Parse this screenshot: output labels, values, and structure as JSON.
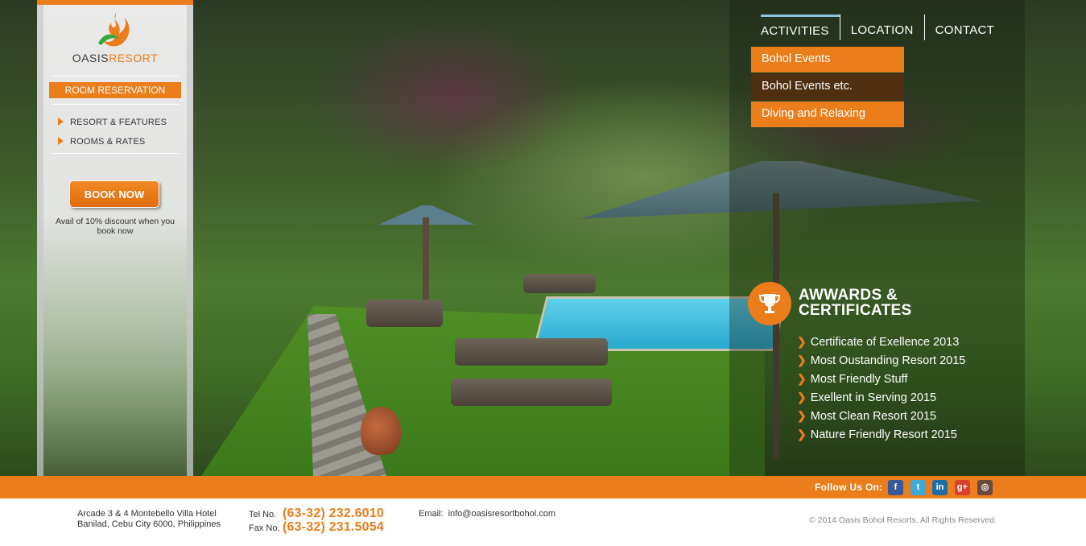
{
  "brand": {
    "name_part1": "OASIS",
    "name_part2": "RESORT",
    "accent_color": "#ec7d1b"
  },
  "sidebar": {
    "reservation_label": "ROOM RESERVATION",
    "links": [
      {
        "label": "RESORT & FEATURES",
        "icon": "triangle-right-icon"
      },
      {
        "label": "ROOMS & RATES",
        "icon": "triangle-right-icon"
      }
    ],
    "book_button": "BOOK NOW",
    "discount_text": "Avail of 10% discount when you book now"
  },
  "nav": {
    "items": [
      {
        "label": "ACTIVITIES",
        "active": true
      },
      {
        "label": "LOCATION"
      },
      {
        "label": "CONTACT"
      }
    ],
    "dropdown": [
      {
        "label": "Bohol Events"
      },
      {
        "label": "Bohol Events etc.",
        "highlighted": true
      },
      {
        "label": "Diving and Relaxing"
      }
    ]
  },
  "awards": {
    "title_line1": "AWWARDS &",
    "title_line2": "CERTIFICATES",
    "icon": "trophy-icon",
    "items": [
      "Certificate of Exellence 2013",
      "Most Oustanding Resort 2015",
      "Most Friendly Stuff",
      "Exellent in Serving 2015",
      "Most Clean Resort 2015",
      "Nature Friendly Resort 2015"
    ]
  },
  "follow": {
    "label": "Follow Us On:",
    "networks": [
      {
        "icon": "facebook-icon",
        "glyph": "f"
      },
      {
        "icon": "twitter-icon",
        "glyph": "t"
      },
      {
        "icon": "linkedin-icon",
        "glyph": "in"
      },
      {
        "icon": "googleplus-icon",
        "glyph": "g+"
      },
      {
        "icon": "instagram-icon",
        "glyph": "◎"
      }
    ]
  },
  "footer": {
    "address_line1": "Arcade 3 & 4 Montebello Villa Hotel",
    "address_line2": "Banilad, Cebu City 6000, Philippines",
    "tel_label": "Tel No.",
    "tel_number": "(63-32) 232.6010",
    "fax_label": "Fax No.",
    "fax_number": "(63-32) 231.5054",
    "email_label": "Email:",
    "email_value": "info@oasisresortbohol.com",
    "copyright": "© 2014 Oasis Bohol Resorts. All Rights Reserved."
  }
}
